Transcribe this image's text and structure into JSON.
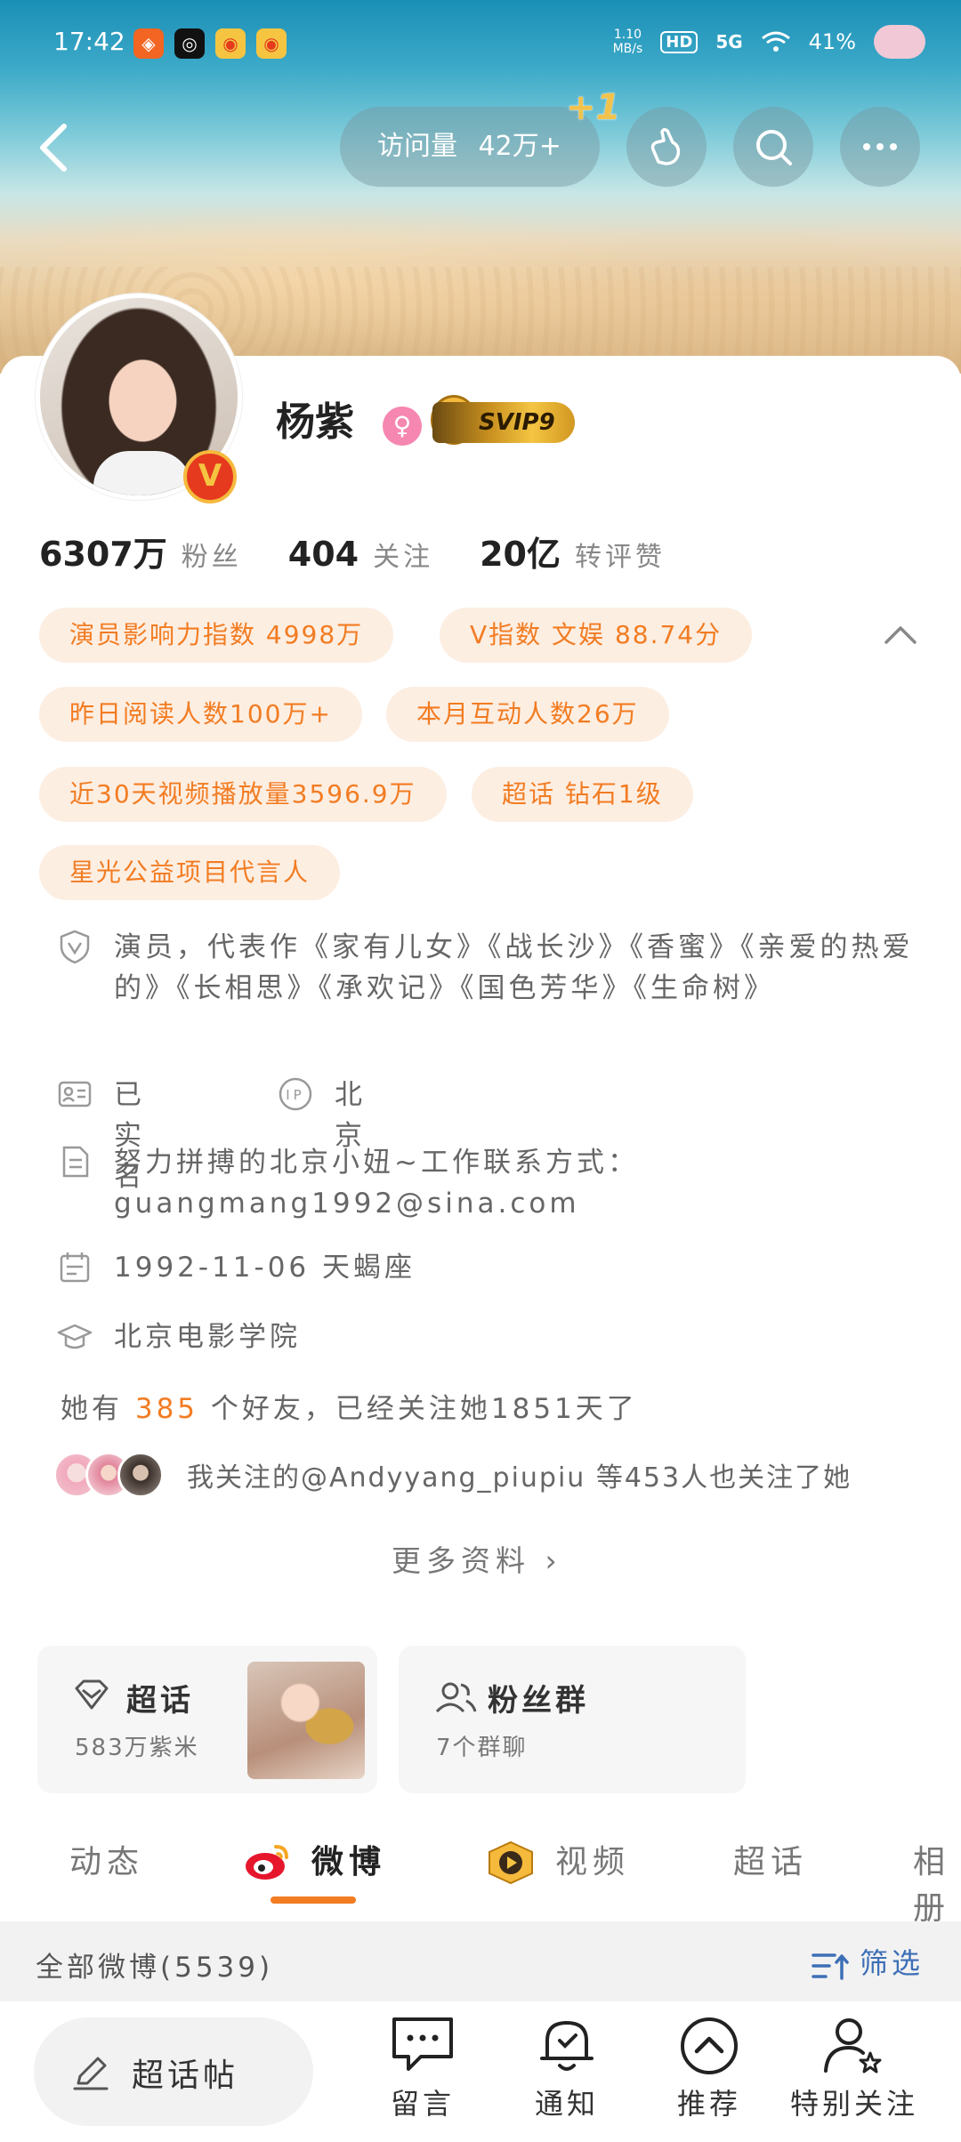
{
  "status_bar": {
    "time": "17:42",
    "net_speed": "1.10\nMB/s",
    "hd": "HD",
    "network": "5G",
    "battery": "41%"
  },
  "nav": {
    "visits_label": "访问量",
    "visits_value": "42万+",
    "visits_increment": "+1"
  },
  "profile": {
    "name": "杨紫",
    "vip_badge": "SVIP9",
    "verified_badge": "V",
    "stats": [
      {
        "value": "6307万",
        "label": "粉丝"
      },
      {
        "value": "404",
        "label": "关注"
      },
      {
        "value": "20亿",
        "label": "转评赞"
      }
    ],
    "tags": [
      "演员影响力指数 4998万",
      "V指数 文娱 88.74分",
      "昨日阅读人数100万+",
      "本月互动人数26万",
      "近30天视频播放量3596.9万",
      "超话 钻石1级",
      "星光公益项目代言人"
    ],
    "description": "演员，代表作《家有儿女》《战长沙》《香蜜》《亲爱的热爱的》《长相思》《承欢记》《国色芳华》《生命树》",
    "real_name": "已实名",
    "ip_location": "北京",
    "bio": "努力拼搏的北京小妞~工作联系方式：guangmang1992@sina.com",
    "birthday": "1992-11-06 天蝎座",
    "school": "北京电影学院",
    "friends_prefix": "她有",
    "friends_count": "385",
    "friends_suffix": "个好友，已经关注她1851天了",
    "mutual_follow_text": "我关注的@Andyyang_piupiu 等453人也关注了她",
    "more_info": "更多资料 ›"
  },
  "cards": {
    "super_topic": {
      "title": "超话",
      "subtitle": "583万紫米"
    },
    "fan_group": {
      "title": "粉丝群",
      "subtitle": "7个群聊"
    }
  },
  "tabs": [
    {
      "label": "动态"
    },
    {
      "label": "微博"
    },
    {
      "label": "视频"
    },
    {
      "label": "超话"
    },
    {
      "label": "相册"
    }
  ],
  "filter": {
    "label": "全部微博(5539)",
    "button": "筛选"
  },
  "bottom_bar": {
    "compose": "超话帖",
    "items": [
      "留言",
      "通知",
      "推荐",
      "特别关注"
    ]
  },
  "colors": {
    "accent": "#f27c22",
    "tag_bg": "#fdeee2",
    "link_blue": "#3d6fb6"
  }
}
